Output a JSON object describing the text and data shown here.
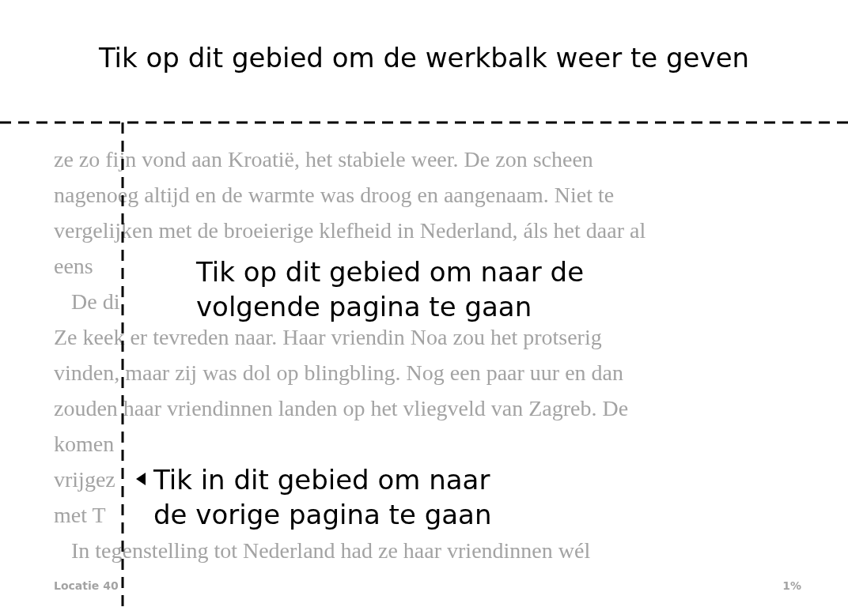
{
  "toolbar_hint": {
    "text": "Tik op dit gebied om de werkbalk weer te geven"
  },
  "page": {
    "lines": [
      {
        "kind": "line",
        "text": "ze zo fijn vond aan Kroatië, het stabiele weer. De zon scheen"
      },
      {
        "kind": "line",
        "text": "nagenoeg altijd en de warmte was droog en aangenaam. Niet te"
      },
      {
        "kind": "line",
        "text": "vergelijken met de broeierige klefheid in Nederland, áls het daar al"
      },
      {
        "kind": "line",
        "text": "eens"
      },
      {
        "kind": "paragraph_start",
        "text": "De di"
      },
      {
        "kind": "line",
        "text": "Ze keek er tevreden naar. Haar vriendin Noa zou het protserig"
      },
      {
        "kind": "line",
        "text": "vinden, maar zij was dol op blingbling. Nog een paar uur en dan"
      },
      {
        "kind": "line",
        "text": "zouden haar vriendinnen landen op het vliegveld van Zagreb. De"
      },
      {
        "kind": "line",
        "text": "komen"
      },
      {
        "kind": "line",
        "text": "vrijgez"
      },
      {
        "kind": "line",
        "text": "met T"
      },
      {
        "kind": "paragraph_start",
        "text": "In tegenstelling tot Nederland had ze haar vriendinnen wél"
      }
    ]
  },
  "next_page_hint": {
    "text": "Tik op dit gebied om naar de volgende pagina te gaan"
  },
  "previous_page_hint": {
    "text": "Tik in dit gebied om naar de vorige pagina te gaan"
  },
  "footer": {
    "location": "Locatie 40",
    "progress": "1%"
  }
}
